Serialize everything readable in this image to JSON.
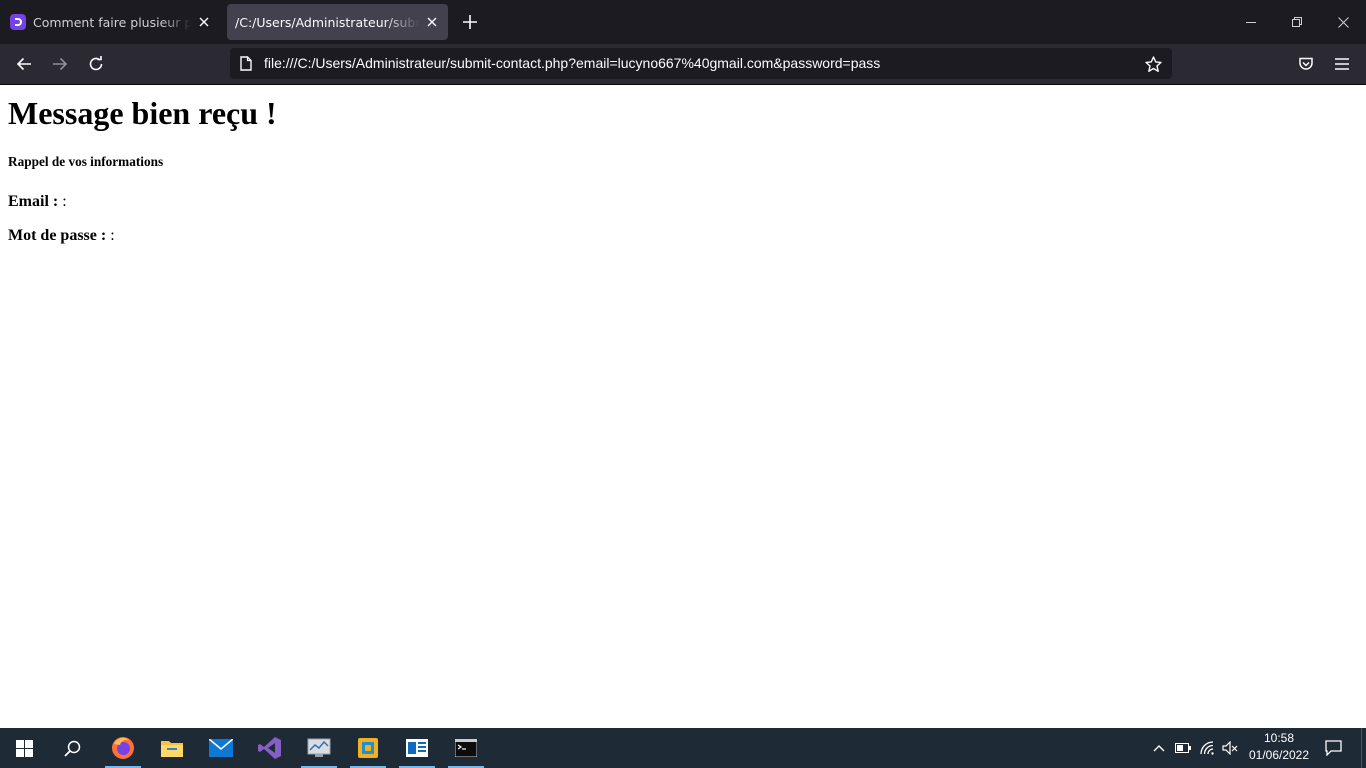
{
  "browser": {
    "tabs": [
      {
        "title": "Comment faire plusieur page en HTML",
        "favicon": "discord-like-icon",
        "active": false
      },
      {
        "title": "/C:/Users/Administrateur/submit-contact.php",
        "favicon": "",
        "active": true
      }
    ],
    "url": "file:///C:/Users/Administrateur/submit-contact.php?email=lucyno667%40gmail.com&password=pass",
    "colors": {
      "tabbar": "#1c1b22",
      "toolbar": "#2b2a33",
      "active_tab": "#42414d",
      "url_field": "#1c1b22"
    }
  },
  "page": {
    "heading": "Message bien reçu !",
    "subheading": "Rappel de vos informations",
    "fields": [
      {
        "label": "Email :",
        "value": ":"
      },
      {
        "label": "Mot de passe :",
        "value": ":"
      }
    ]
  },
  "taskbar": {
    "apps": [
      "windows-start-icon",
      "search-icon",
      "firefox-icon",
      "file-explorer-icon",
      "mail-icon",
      "visual-studio-icon",
      "system-monitor-icon",
      "app-icon",
      "outlook-icon",
      "terminal-icon"
    ],
    "clock": {
      "time": "10:58",
      "date": "01/06/2022"
    },
    "colors": {
      "background": "#1f2a37",
      "running_indicator": "#76b9ed"
    }
  }
}
